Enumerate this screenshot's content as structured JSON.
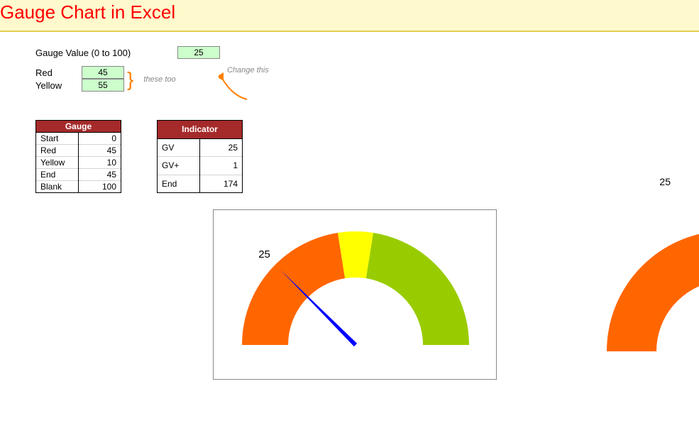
{
  "title": "Gauge Chart in Excel",
  "inputs": {
    "gauge_value_label": "Gauge Value (0 to 100)",
    "gauge_value": "25",
    "change_note": "Change this",
    "these_note": "these too",
    "red_label": "Red",
    "red_value": "45",
    "yellow_label": "Yellow",
    "yellow_value": "55"
  },
  "tables": {
    "gauge": {
      "header": "Gauge",
      "rows": [
        {
          "k": "Start",
          "v": "0"
        },
        {
          "k": "Red",
          "v": "45"
        },
        {
          "k": "Yellow",
          "v": "10"
        },
        {
          "k": "End",
          "v": "45"
        },
        {
          "k": "Blank",
          "v": "100"
        }
      ]
    },
    "indicator": {
      "header": "Indicator",
      "rows": [
        {
          "k": "GV",
          "v": "25"
        },
        {
          "k": "GV+",
          "v": "1"
        },
        {
          "k": "End",
          "v": "174"
        }
      ]
    }
  },
  "side_label": "25",
  "chart_data": {
    "type": "pie",
    "title": "Gauge Chart in Excel",
    "gauge_value": 25,
    "red_threshold": 45,
    "yellow_threshold": 55,
    "series": [
      {
        "name": "Gauge",
        "categories": [
          "Start",
          "Red",
          "Yellow",
          "End",
          "Blank"
        ],
        "values": [
          0,
          45,
          10,
          45,
          100
        ],
        "colors": [
          "",
          "#ff6600",
          "#ffff00",
          "#99cc00",
          "transparent"
        ]
      },
      {
        "name": "Indicator",
        "categories": [
          "GV",
          "GV+",
          "End"
        ],
        "values": [
          25,
          1,
          174
        ],
        "colors": [
          "transparent",
          "#0000ff",
          "transparent"
        ]
      }
    ],
    "needle_label": "25"
  }
}
